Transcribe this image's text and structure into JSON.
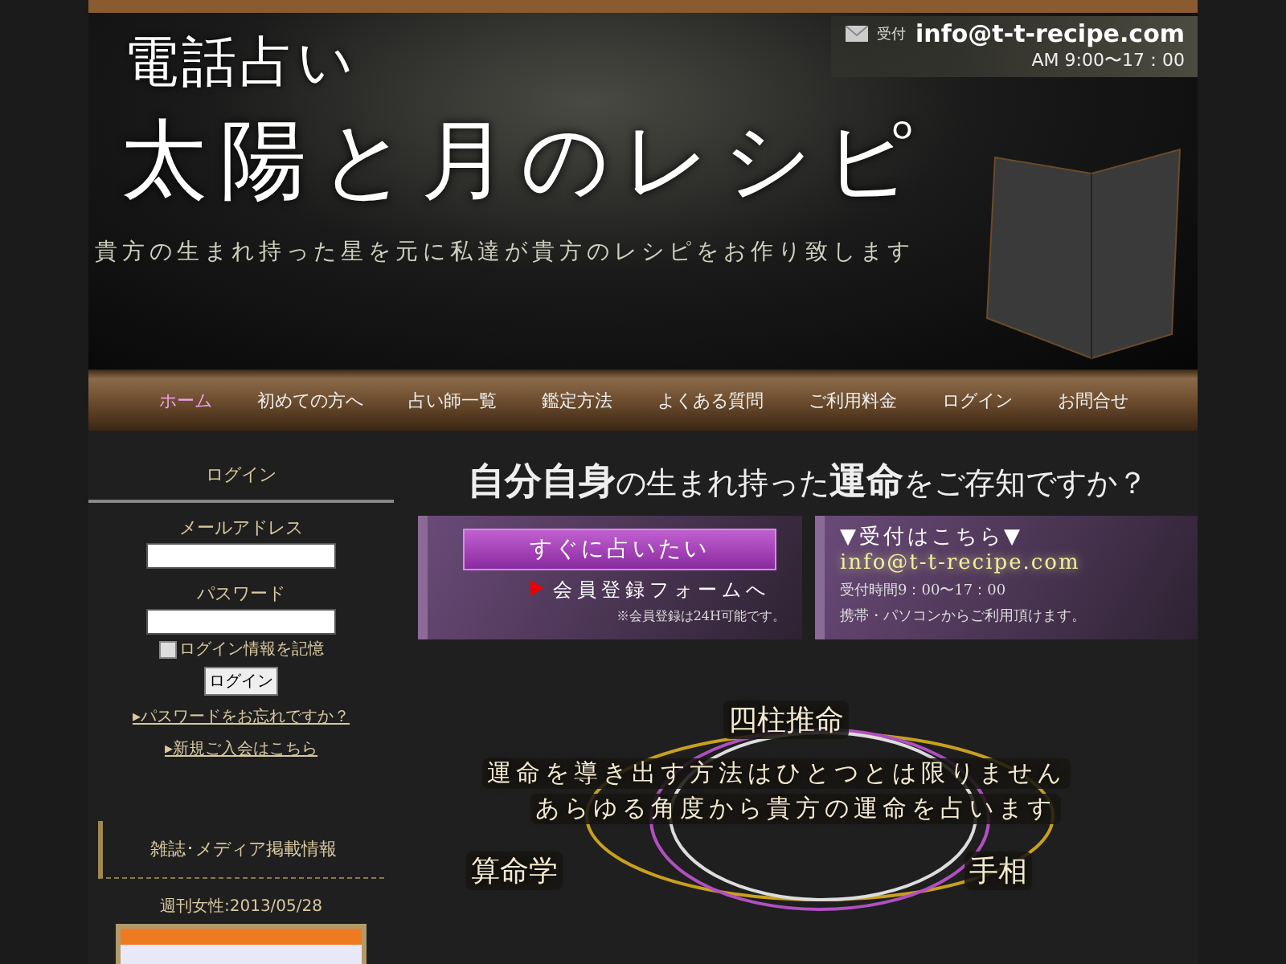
{
  "header": {
    "kicker": "電話占い",
    "title": "太陽と月のレシピ",
    "subtitle": "貴方の生まれ持った星を元に私達が貴方のレシピをお作り致します",
    "contact": {
      "label": "受付",
      "email": "info@t-t-recipe.com",
      "hours": "AM 9:00〜17：00"
    }
  },
  "nav": [
    {
      "label": "ホーム",
      "selected": true
    },
    {
      "label": "初めての方へ",
      "selected": false
    },
    {
      "label": "占い師一覧",
      "selected": false
    },
    {
      "label": "鑑定方法",
      "selected": false
    },
    {
      "label": "よくある質問",
      "selected": false
    },
    {
      "label": "ご利用料金",
      "selected": false
    },
    {
      "label": "ログイン",
      "selected": false
    },
    {
      "label": "お問合せ",
      "selected": false
    }
  ],
  "sidebar": {
    "login": {
      "title": "ログイン",
      "email_label": "メールアドレス",
      "password_label": "パスワード",
      "remember": {
        "label": "ログイン情報を記憶",
        "checked": false
      },
      "button": "ログイン",
      "links": [
        "▸パスワードをお忘れですか？",
        "▸新規ご入会はこちら"
      ]
    },
    "media": {
      "title": "雑誌･メディア掲載情報",
      "caption": "週刊女性:2013/05/28"
    }
  },
  "main": {
    "headline": "**自分自身**の生まれ持った**運命**をご存知ですか？",
    "join": {
      "button": "すぐに占いたい",
      "link": "会員登録フォームへ",
      "note": "※会員登録は24H可能です。"
    },
    "reception": {
      "title": "▼受付はこちら▼",
      "email": "info@t-t-recipe.com",
      "hours": "受付時間9：00〜17：00",
      "note": "携帯・パソコンからご利用頂けます。"
    },
    "methods": {
      "top": "四柱推命",
      "lines": [
        "運命を導き出す方法はひとつとは限りません",
        "あらゆる角度から貴方の運命を占います"
      ],
      "left": "算命学",
      "right": "手相"
    }
  }
}
